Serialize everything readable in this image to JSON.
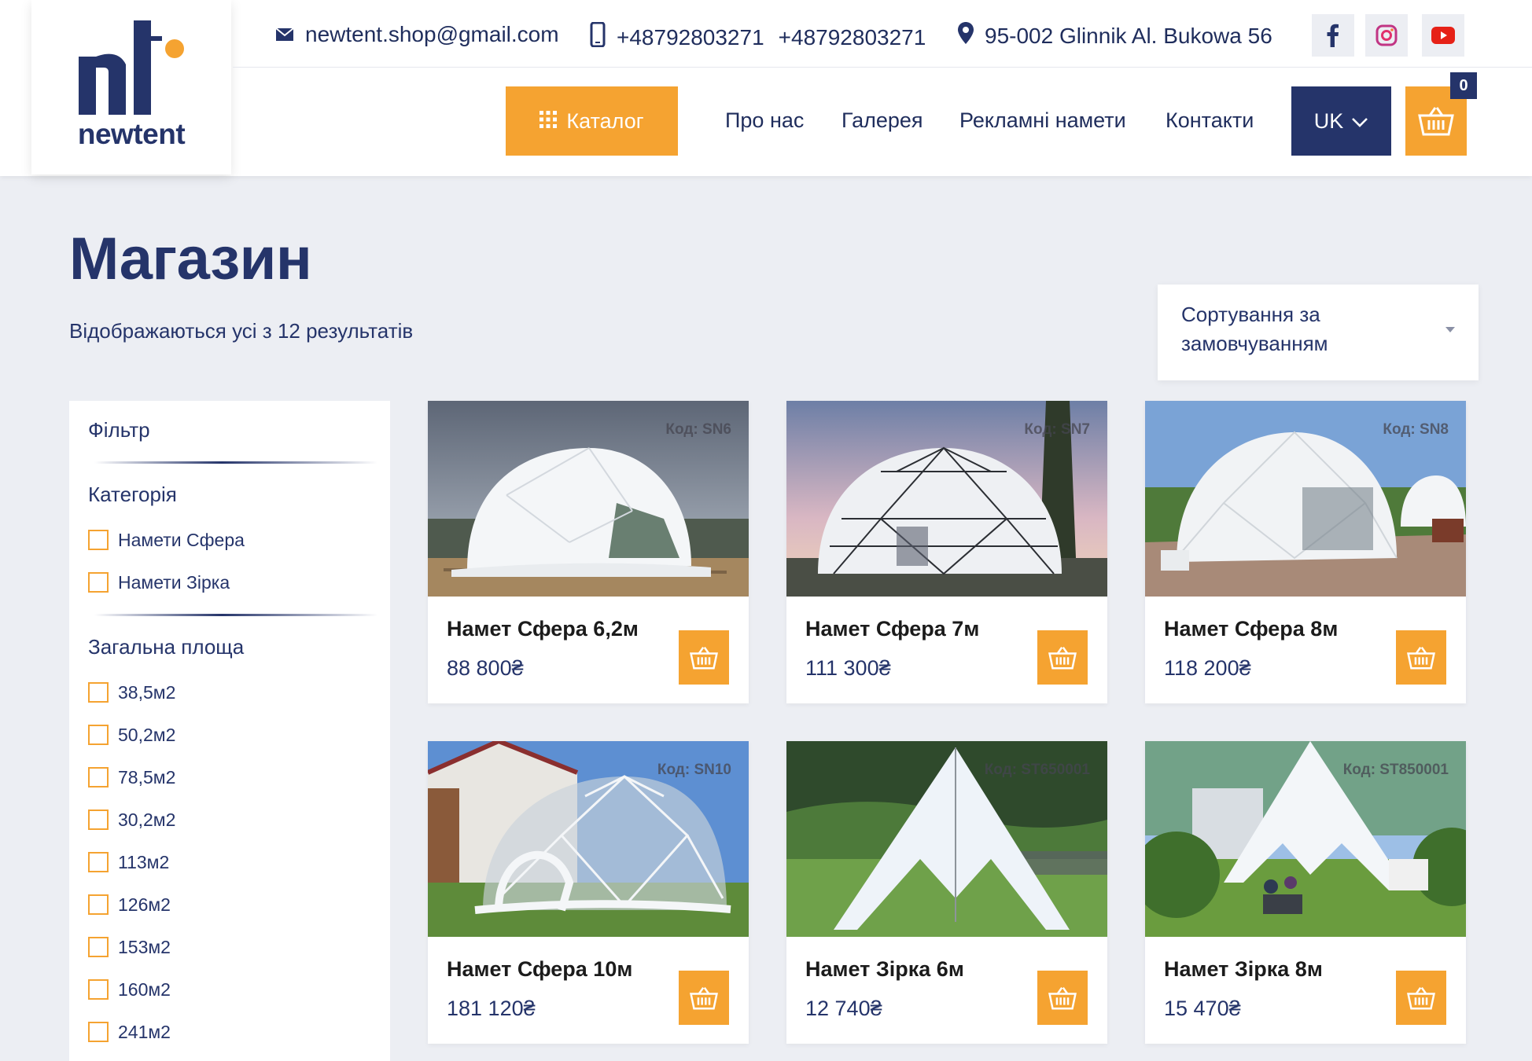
{
  "brand": {
    "name": "newtent"
  },
  "contacts": {
    "email": "newtent.shop@gmail.com",
    "phone1": "+48792803271",
    "phone2": "+48792803271",
    "address": "95-002 Glinnik Al. Bukowa 56"
  },
  "social": [
    "facebook-icon",
    "instagram-icon",
    "youtube-icon"
  ],
  "nav": {
    "catalog": "Каталог",
    "about": "Про нас",
    "gallery": "Галерея",
    "ads": "Рекламні намети",
    "contacts": "Контакти",
    "lang": "UK",
    "cart_count": "0"
  },
  "page": {
    "title": "Магазин",
    "results": "Відображаються усі з 12 результатів",
    "sort": "Сортування за замовчуванням"
  },
  "filter": {
    "title": "Фільтр",
    "category_title": "Категорія",
    "categories": [
      "Намети Сфера",
      "Намети Зірка"
    ],
    "area_title": "Загальна площа",
    "areas": [
      "38,5м2",
      "50,2м2",
      "78,5м2",
      "30,2м2",
      "113м2",
      "126м2",
      "153м2",
      "160м2",
      "241м2"
    ]
  },
  "products": [
    {
      "code": "Код: SN6",
      "name": "Намет Сфера 6,2м",
      "price": "88 800₴"
    },
    {
      "code": "Код: SN7",
      "name": "Намет Сфера 7м",
      "price": "111 300₴"
    },
    {
      "code": "Код: SN8",
      "name": "Намет Сфера 8м",
      "price": "118 200₴"
    },
    {
      "code": "Код: SN10",
      "name": "Намет Сфера 10м",
      "price": "181 120₴"
    },
    {
      "code": "Код: ST650001",
      "name": "Намет Зірка 6м",
      "price": "12 740₴"
    },
    {
      "code": "Код: ST850001",
      "name": "Намет Зірка 8м",
      "price": "15 470₴"
    }
  ],
  "colors": {
    "accent": "#f5a331",
    "brand": "#25346a",
    "background": "#eceef3"
  }
}
